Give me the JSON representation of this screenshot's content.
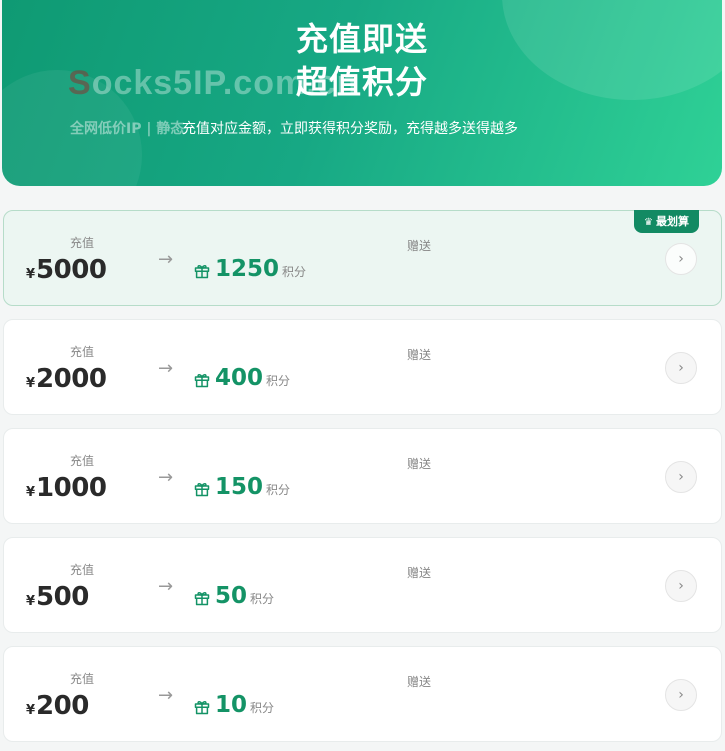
{
  "hero": {
    "title_line1": "充值即送",
    "title_line2": "超值积分",
    "subtitle": "充值对应金额，立即获得积分奖励，充得越多送得越多",
    "watermark_initial": "S",
    "watermark_rest": "ocks5IP.com.cn",
    "tagline_behind": "全网低价IP | 静态"
  },
  "labels": {
    "recharge": "充值",
    "gift": "赠送",
    "points_unit": "积分",
    "currency": "¥",
    "best_value_badge": "最划算"
  },
  "packages": [
    {
      "amount": "5000",
      "bonus": "1250",
      "best": true
    },
    {
      "amount": "2000",
      "bonus": "400",
      "best": false
    },
    {
      "amount": "1000",
      "bonus": "150",
      "best": false
    },
    {
      "amount": "500",
      "bonus": "50",
      "best": false
    },
    {
      "amount": "200",
      "bonus": "10",
      "best": false
    }
  ],
  "colors": {
    "accent": "#149366",
    "hero_start": "#0f9a73",
    "hero_end": "#2fd196",
    "badge": "#128a63"
  },
  "icons": {
    "arrow": "arrow-right-icon",
    "gift": "gift-icon",
    "go": "chevron-right-icon",
    "crown": "crown-icon"
  }
}
